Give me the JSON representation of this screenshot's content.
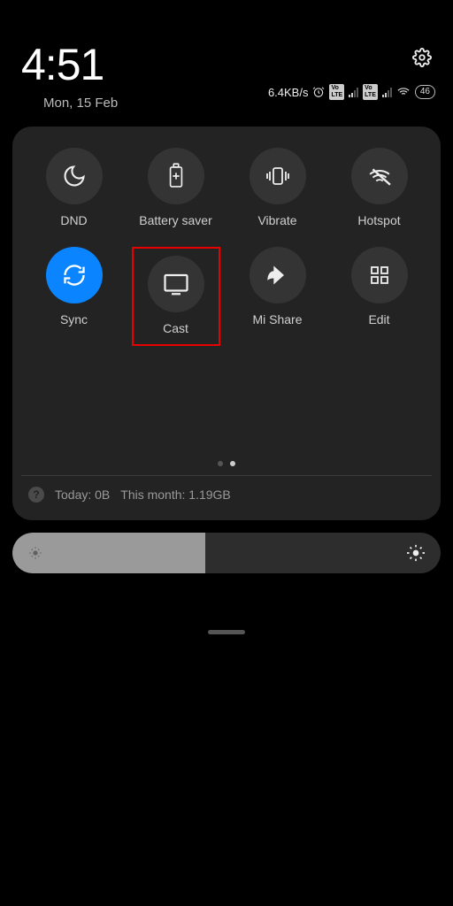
{
  "status": {
    "time": "4:51",
    "date": "Mon, 15 Feb",
    "net_speed": "6.4KB/s",
    "battery": "46"
  },
  "tiles": {
    "dnd": "DND",
    "battery_saver": "Battery saver",
    "vibrate": "Vibrate",
    "hotspot": "Hotspot",
    "sync": "Sync",
    "cast": "Cast",
    "mi_share": "Mi Share",
    "edit": "Edit"
  },
  "usage": {
    "today_label": "Today: 0B",
    "month_label": "This month: 1.19GB"
  },
  "brightness": {
    "level_percent": 45
  }
}
